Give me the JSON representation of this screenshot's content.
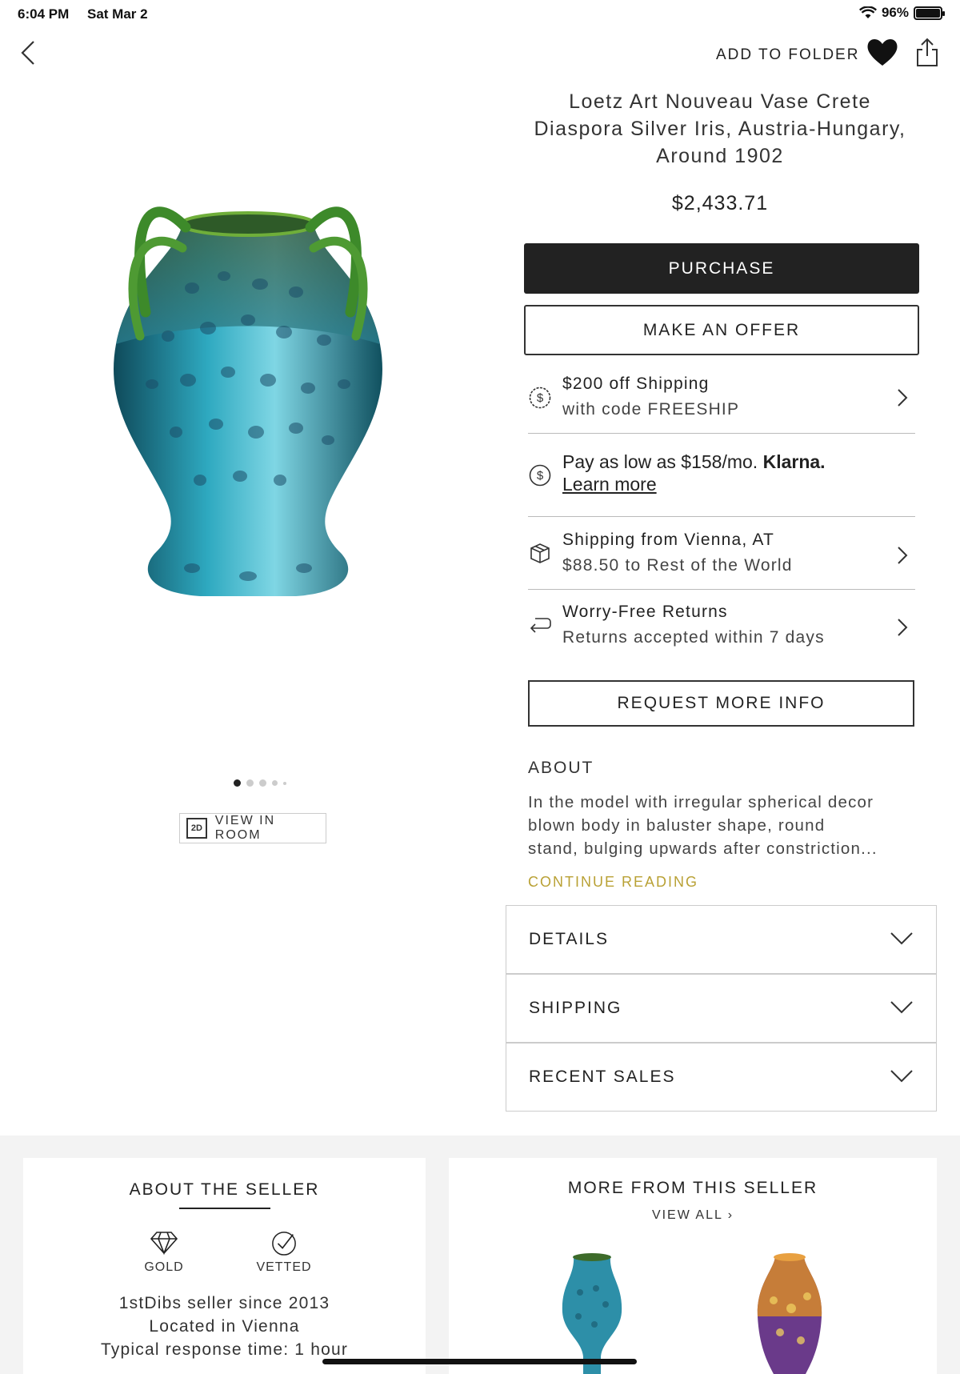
{
  "status": {
    "time": "6:04 PM",
    "date": "Sat Mar 2",
    "battery": "96%"
  },
  "nav": {
    "add_to_folder": "ADD TO FOLDER"
  },
  "product": {
    "title_lines": [
      "Loetz Art Nouveau Vase Crete",
      "Diaspora Silver Iris, Austria-Hungary,",
      "Around 1902"
    ],
    "price": "$2,433.71",
    "purchase": "PURCHASE",
    "make_offer": "MAKE AN OFFER",
    "view_in_room": "VIEW IN ROOM",
    "view_in_room_badge": "2D",
    "image_dots": 5,
    "active_dot": 1
  },
  "info": {
    "shipping_promo": {
      "line1": "$200 off Shipping",
      "line2": "with code FREESHIP"
    },
    "klarna": {
      "text": "Pay as low as $158/mo.",
      "brand": "Klarna.",
      "link": "Learn more"
    },
    "shipping_from": {
      "line1": "Shipping from Vienna, AT",
      "line2": "$88.50 to Rest of the World"
    },
    "returns": {
      "line1": "Worry-Free Returns",
      "line2": "Returns accepted within 7 days"
    }
  },
  "request_info": "REQUEST MORE INFO",
  "about": {
    "heading": "ABOUT",
    "lines": [
      "In the model with irregular spherical decor",
      "blown body in baluster shape, round",
      "stand, bulging upwards after constriction..."
    ],
    "continue": "CONTINUE READING"
  },
  "accordions": [
    "DETAILS",
    "SHIPPING",
    "RECENT SALES"
  ],
  "seller": {
    "heading": "ABOUT THE SELLER",
    "badges": [
      "GOLD",
      "VETTED"
    ],
    "since": "1stDibs seller since 2013",
    "location": "Located in Vienna",
    "response": "Typical response time: 1 hour"
  },
  "more": {
    "heading": "MORE FROM THIS SELLER",
    "view_all": "VIEW ALL"
  },
  "icons": [
    "back-icon",
    "heart-icon",
    "share-icon",
    "dollar-icon",
    "box-icon",
    "return-icon",
    "chevron-right-icon",
    "chevron-down-icon",
    "diamond-icon",
    "check-circle-icon"
  ],
  "colors": {
    "purchase_bg": "#222222",
    "continue": "#b9a135",
    "band": "#f3f3f3"
  }
}
